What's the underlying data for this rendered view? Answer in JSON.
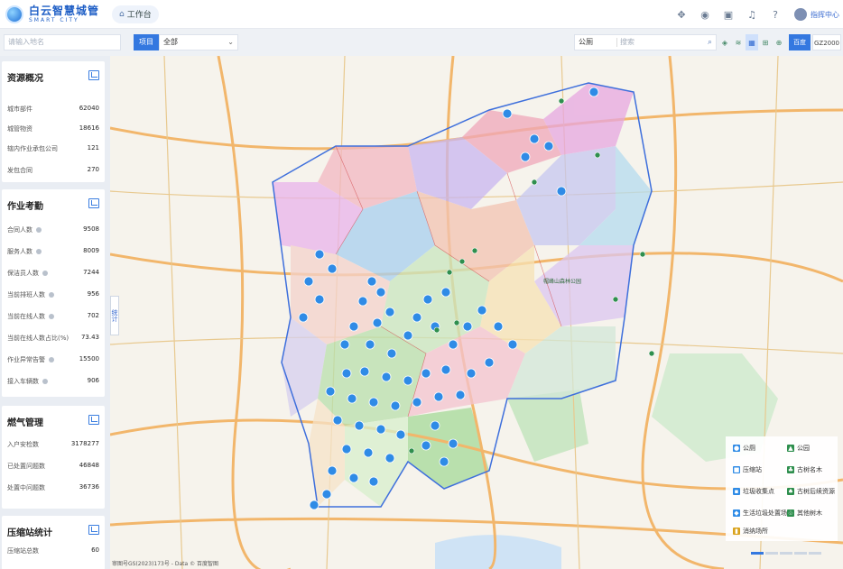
{
  "header": {
    "logo_title": "白云智慧城管",
    "logo_sub": "SMART CITY",
    "workbench_label": "工作台",
    "username": "指挥中心"
  },
  "toolbar": {
    "search_placeholder": "请输入地名",
    "project_label": "项目",
    "project_value": "全部",
    "category_value": "公厕",
    "search_right_placeholder": "搜索",
    "baidu_label": "百度",
    "gz_label": "GZ2000"
  },
  "sidebar": {
    "resource": {
      "title": "资源概况",
      "rows": [
        {
          "label": "城市部件",
          "value": "62040"
        },
        {
          "label": "城管物资",
          "value": "18616"
        },
        {
          "label": "辖内作业承包公司",
          "value": "121"
        },
        {
          "label": "发包合同",
          "value": "270"
        }
      ]
    },
    "attendance": {
      "title": "作业考勤",
      "rows": [
        {
          "label": "合同人数",
          "value": "9508"
        },
        {
          "label": "服务人数",
          "value": "8009"
        },
        {
          "label": "保洁员人数",
          "value": "7244"
        },
        {
          "label": "当前排班人数",
          "value": "956"
        },
        {
          "label": "当前在线人数",
          "value": "702"
        },
        {
          "label": "当前在线人数占比(%)",
          "value": "73.43"
        },
        {
          "label": "作业异常告警",
          "value": "15500"
        },
        {
          "label": "接入车辆数",
          "value": "906"
        }
      ]
    },
    "gas": {
      "title": "燃气管理",
      "rows": [
        {
          "label": "入户安检数",
          "value": "3178277"
        },
        {
          "label": "已处置问题数",
          "value": "46848"
        },
        {
          "label": "处置中问题数",
          "value": "36736"
        }
      ]
    },
    "compress": {
      "title": "压缩站统计",
      "rows": [
        {
          "label": "压缩站总数",
          "value": "60"
        }
      ]
    },
    "stat_tab": "统计"
  },
  "map": {
    "footer": "审图号GS(2023)173号 - Data © 百度智图",
    "park_label": "帽峰山森林公园"
  },
  "legend": {
    "items": [
      {
        "label": "公厕",
        "color": "#2f8be6",
        "icon": "toilet-icon"
      },
      {
        "label": "公园",
        "color": "#2f8f4e",
        "icon": "park-icon"
      },
      {
        "label": "压缩站",
        "color": "#2f8be6",
        "icon": "compress-station-icon"
      },
      {
        "label": "古树名木",
        "color": "#2f8f4e",
        "icon": "old-tree-icon"
      },
      {
        "label": "垃圾收集点",
        "color": "#2f8be6",
        "icon": "garbage-point-icon"
      },
      {
        "label": "古树后续资源",
        "color": "#2f8f4e",
        "icon": "tree-reserve-icon"
      },
      {
        "label": "生活垃圾处置场",
        "color": "#2f8be6",
        "icon": "disposal-site-icon"
      },
      {
        "label": "其他树木",
        "color": "#2f8f4e",
        "icon": "other-tree-icon"
      },
      {
        "label": "消纳场所",
        "color": "#d9a21b",
        "icon": "landfill-icon"
      }
    ]
  },
  "colors": {
    "accent": "#3478e0",
    "marker_blue": "#2f8be6",
    "marker_green": "#2f8f4e",
    "boundary_blue": "#3e6fdc",
    "road_orange": "#f2b66b"
  }
}
